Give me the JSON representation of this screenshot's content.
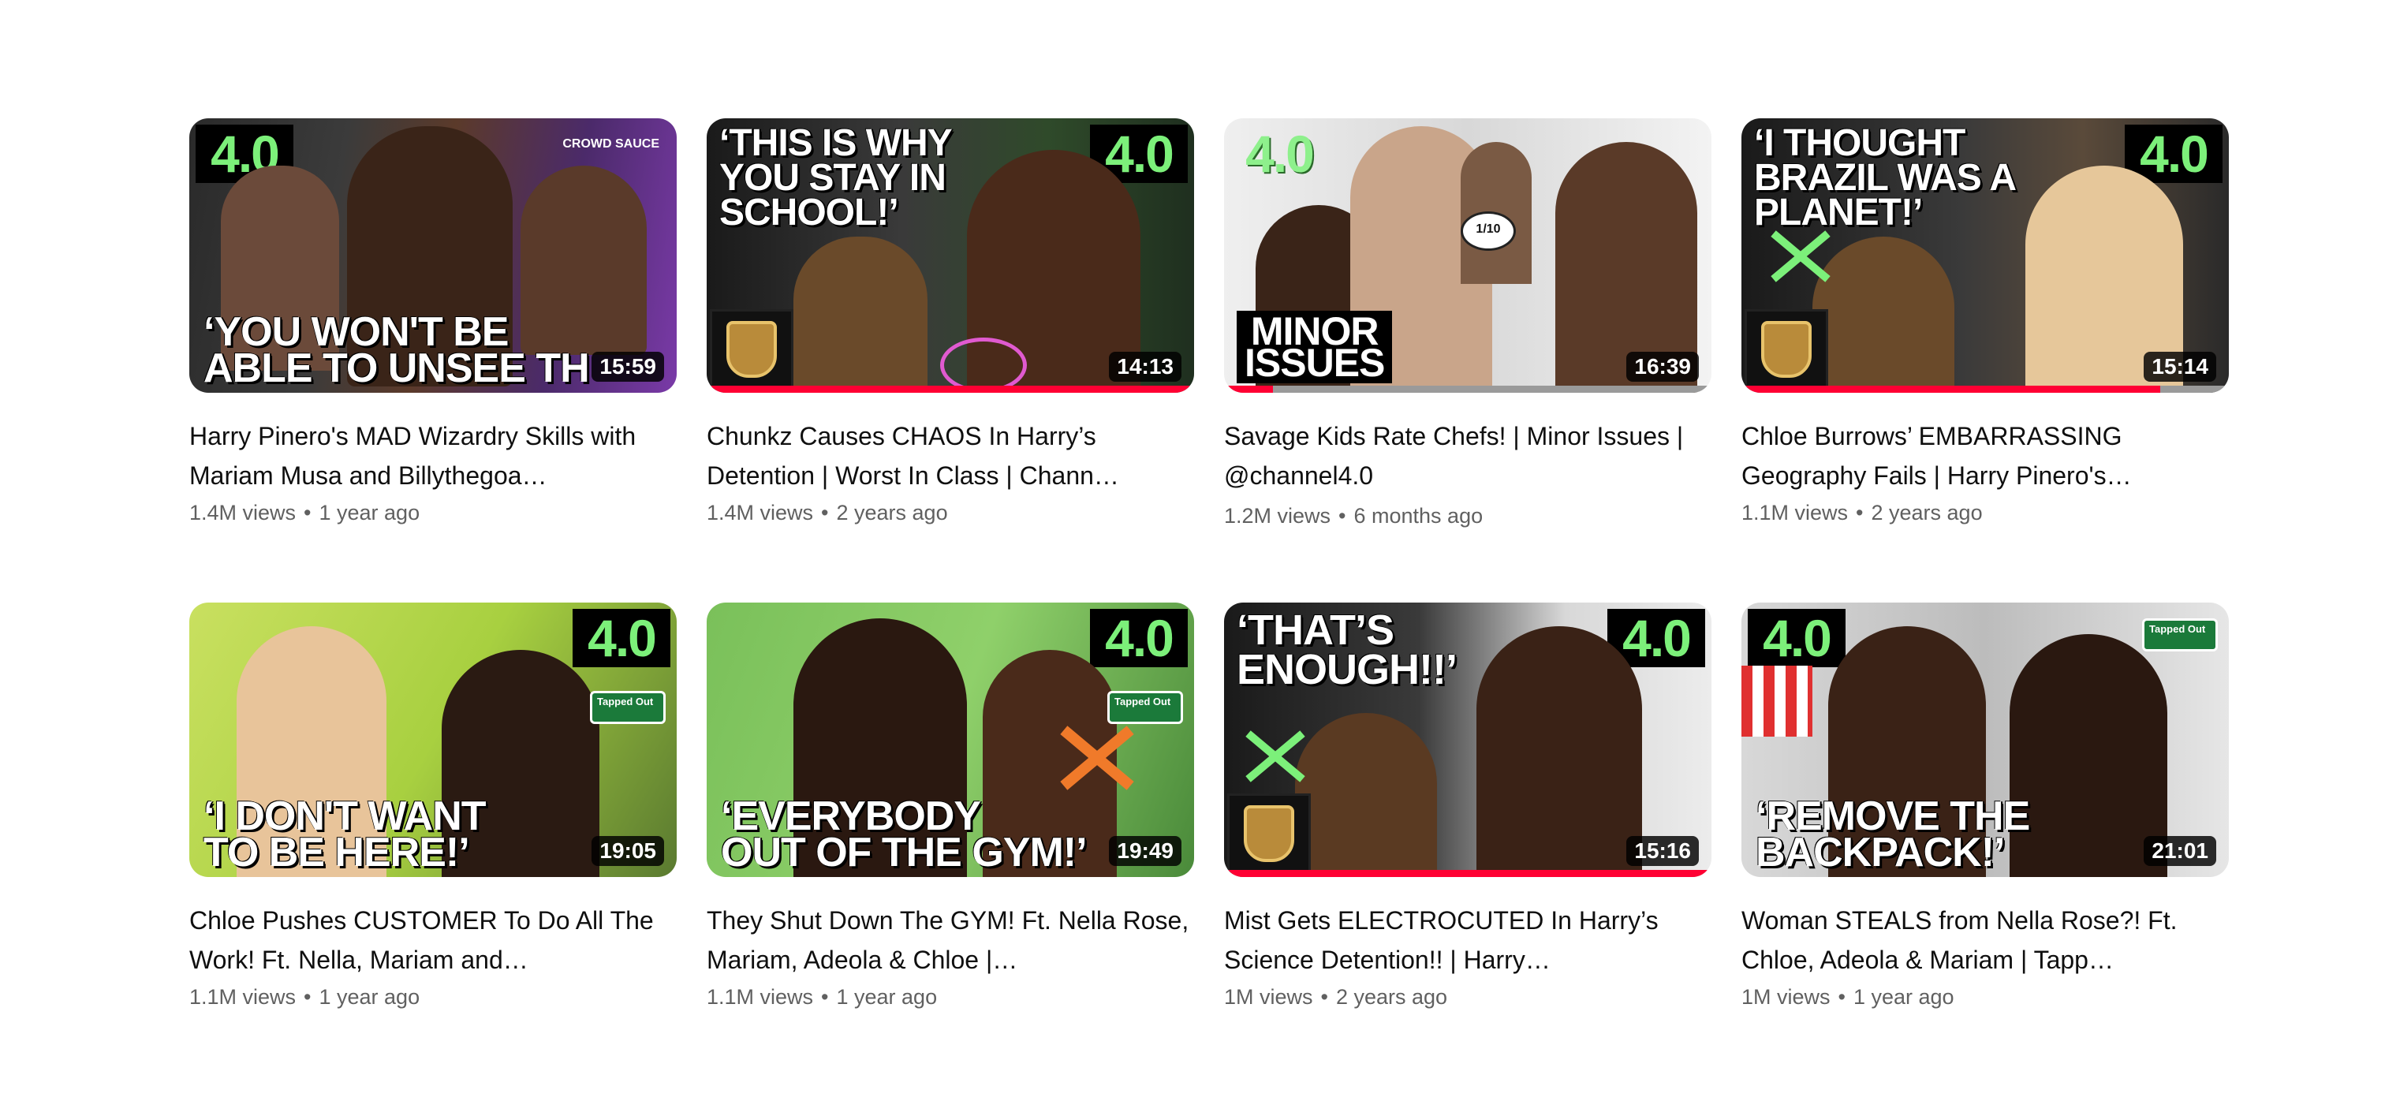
{
  "channel_logo": "4.0",
  "colors": {
    "progress_red": "#ff0033",
    "logo_green": "#7cf07a",
    "meta_gray": "#606060"
  },
  "videos": [
    {
      "title": "Harry Pinero's MAD Wizardry Skills with Mariam Musa and Billythegoa…",
      "views": "1.4M views",
      "age": "1 year ago",
      "duration": "15:59",
      "thumb_text": "‘YOU WON'T BE\nABLE TO UNSEE TH",
      "corner_text": "CROWD SAUCE",
      "watched_fraction": 0
    },
    {
      "title": "Chunkz Causes CHAOS In Harry’s Detention | Worst In Class | Chann…",
      "views": "1.4M views",
      "age": "2 years ago",
      "duration": "14:13",
      "thumb_text": "‘THIS IS WHY\nYOU STAY IN\nSCHOOL!’",
      "watched_fraction": 1.0
    },
    {
      "title": "Savage Kids Rate Chefs! | Minor Issues | @channel4.0",
      "views": "1.2M views",
      "age": "6 months ago",
      "duration": "16:39",
      "thumb_text": "MINOR\nISSUES",
      "corner_text": "1/10",
      "watched_fraction": 0.1
    },
    {
      "title": "Chloe Burrows’ EMBARRASSING Geography Fails | Harry Pinero's…",
      "views": "1.1M views",
      "age": "2 years ago",
      "duration": "15:14",
      "thumb_text": "‘I THOUGHT\nBRAZIL WAS A\nPLANET!’",
      "watched_fraction": 0.86
    },
    {
      "title": "Chloe Pushes CUSTOMER To Do All The Work! Ft. Nella, Mariam and…",
      "views": "1.1M views",
      "age": "1 year ago",
      "duration": "19:05",
      "thumb_text": "‘I DON'T WANT\nTO BE HERE!’",
      "corner_text": "Tapped Out",
      "watched_fraction": 0
    },
    {
      "title": "They Shut Down The GYM! Ft. Nella Rose, Mariam, Adeola & Chloe |…",
      "views": "1.1M views",
      "age": "1 year ago",
      "duration": "19:49",
      "thumb_text": "‘EVERYBODY\nOUT OF THE GYM!’",
      "corner_text": "Tapped Out",
      "watched_fraction": 0
    },
    {
      "title": "Mist Gets ELECTROCUTED In Harry’s Science Detention!! | Harry…",
      "views": "1M views",
      "age": "2 years ago",
      "duration": "15:16",
      "thumb_text": "‘THAT’S\nENOUGH!!’",
      "watched_fraction": 1.0
    },
    {
      "title": "Woman STEALS from Nella Rose?! Ft. Chloe, Adeola & Mariam | Tapp…",
      "views": "1M views",
      "age": "1 year ago",
      "duration": "21:01",
      "thumb_text": "‘REMOVE THE\nBACKPACK!’",
      "corner_text": "Tapped Out",
      "watched_fraction": 0
    }
  ]
}
